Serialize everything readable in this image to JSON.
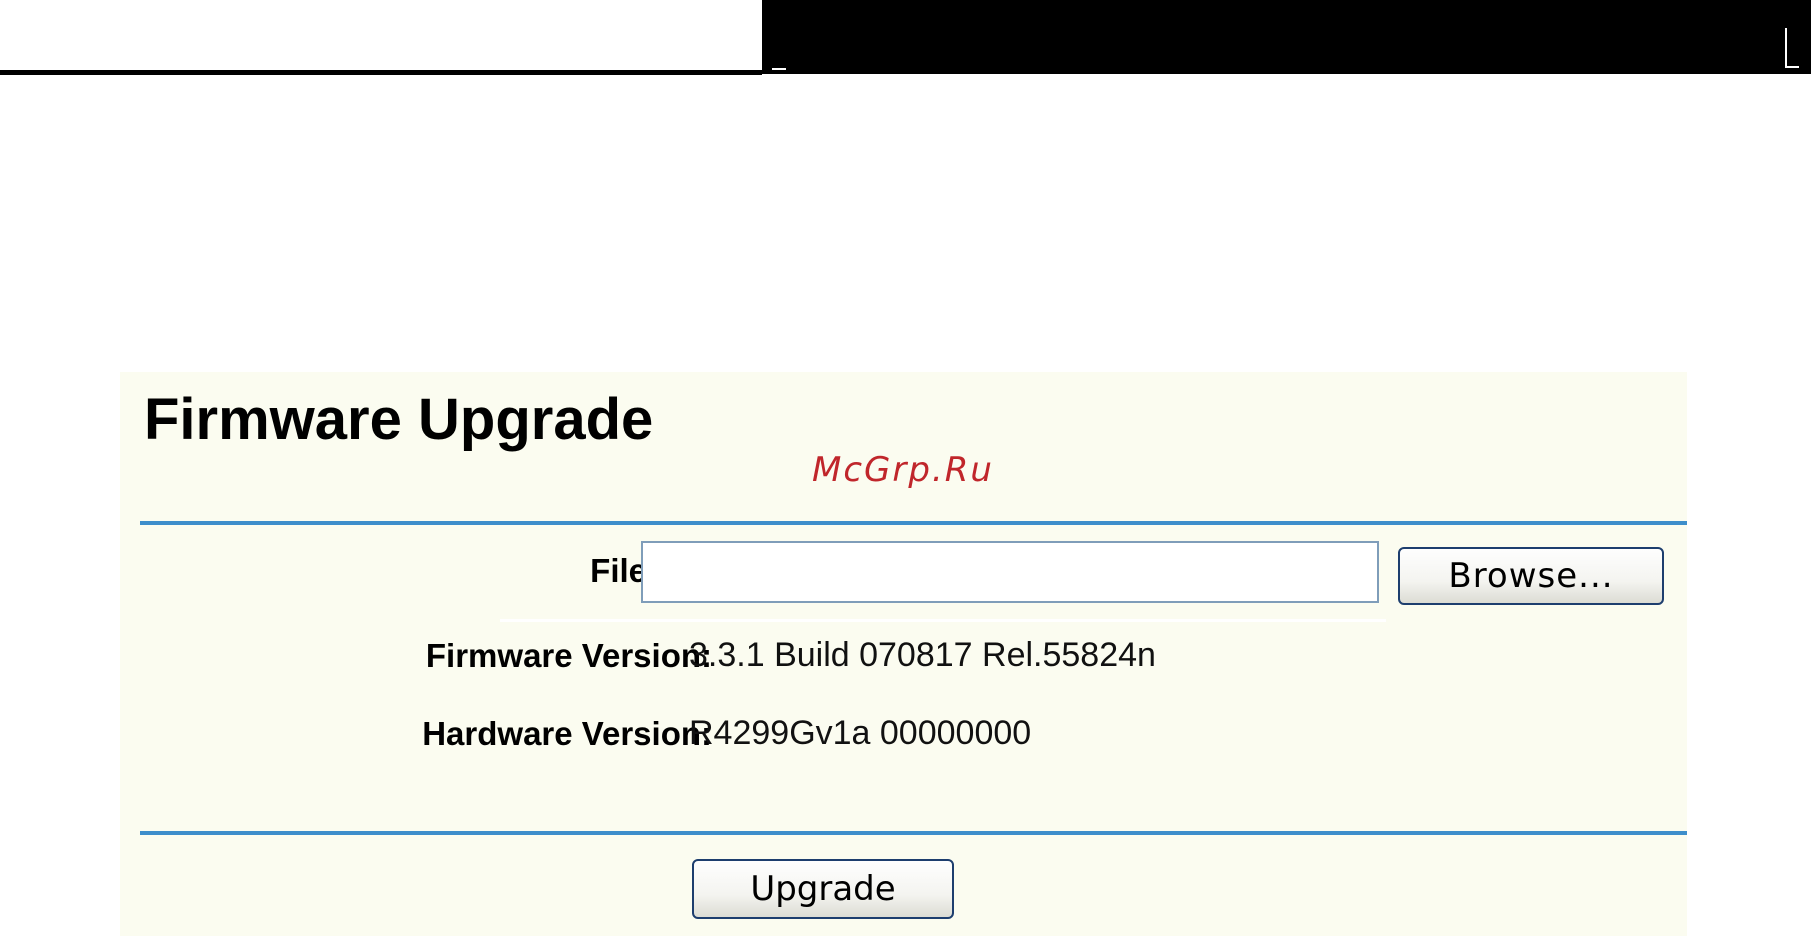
{
  "page": {
    "title": "Firmware Upgrade",
    "watermark": "McGrp.Ru"
  },
  "form": {
    "file_label": "File:",
    "file_value": "",
    "browse_label": "Browse...",
    "firmware_version_label": "Firmware Version:",
    "firmware_version_value": "3.3.1 Build 070817 Rel.55824n",
    "hardware_version_label": "Hardware Version:",
    "hardware_version_value": "R4299Gv1a 00000000",
    "upgrade_label": "Upgrade"
  },
  "colors": {
    "panel_background": "#fbfcf0",
    "rule": "#3d8ecb",
    "watermark": "#c0262b",
    "input_border": "#7f9db9",
    "button_border": "#1d3e6e"
  }
}
